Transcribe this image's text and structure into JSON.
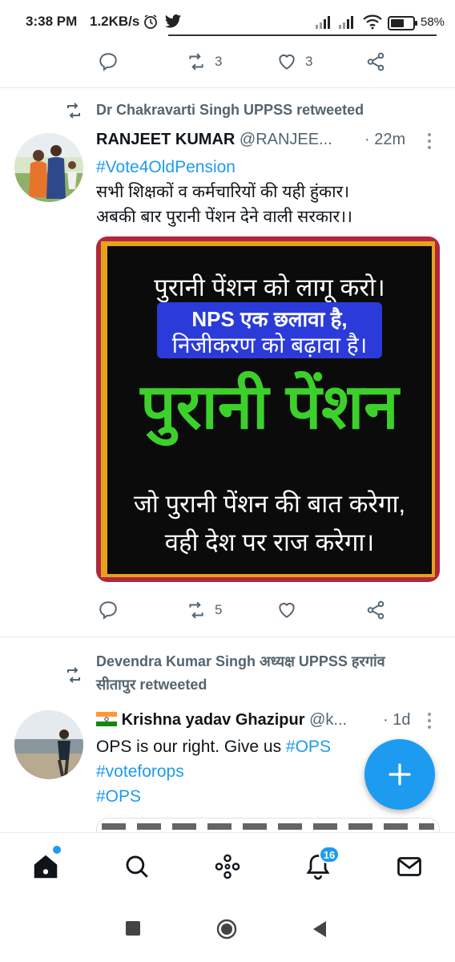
{
  "status_bar": {
    "time": "3:38 PM",
    "speed": "1.2KB/s",
    "battery": "58%",
    "icons": [
      "alarm-icon",
      "twitter-icon",
      "signal-icon",
      "signal-icon",
      "wifi-icon",
      "battery-icon"
    ]
  },
  "tweet0": {
    "reply_count": "",
    "retweet_count": "3",
    "like_count": "3"
  },
  "tweet1": {
    "retweeted_by": "Dr Chakravarti Singh UPPSS retweeted",
    "author_name": "RANJEET KUMAR",
    "author_handle": "@RANJEE...",
    "time": "· 22m",
    "hashtag": "#Vote4OldPension",
    "text_line1": "सभी शिक्षकों व कर्मचारियों की यही हुंकार।",
    "text_line2": "अबकी बार पुरानी पेंशन देने वाली सरकार।।",
    "media": {
      "line1": "पुरानी पेंशन को लागू करो।",
      "band_line1": "NPS एक छलावा है,",
      "band_line2": "निजीकरण को बढ़ावा है।",
      "big_text": "पुरानी पेंशन",
      "line4": "जो पुरानी पेंशन की बात करेगा,",
      "line5": "वही देश पर राज करेगा।"
    },
    "retweet_count": "5"
  },
  "tweet2": {
    "retweeted_by_line1": "Devendra Kumar Singh अध्यक्ष UPPSS हरगांव",
    "retweeted_by_line2": "सीतापुर retweeted",
    "author_name": "Krishna yadav Ghazipur",
    "author_handle": "@k...",
    "time": "· 1d",
    "text_plain": "OPS is our right. Give us ",
    "hashtag1": "#OPS",
    "hashtag2": "#voteforops",
    "hashtag3": "#OPS"
  },
  "bottom_nav": {
    "notification_count": "16",
    "items": [
      "home-icon",
      "search-icon",
      "spaces-icon",
      "notifications-icon",
      "messages-icon"
    ]
  },
  "colors": {
    "accent": "#1d9bf0",
    "secondary_text": "#536471",
    "poster_green": "#3bd12a",
    "poster_band": "#2b3bd9"
  }
}
